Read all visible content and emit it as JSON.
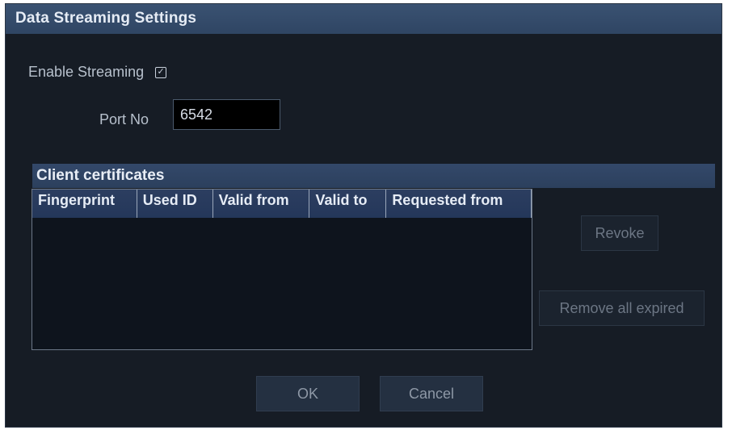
{
  "dialog": {
    "title": "Data Streaming Settings"
  },
  "streaming": {
    "enable_label": "Enable Streaming",
    "enabled": true,
    "port_label": "Port No",
    "port_value": "6542"
  },
  "certificates": {
    "group_title": "Client certificates",
    "columns": [
      "Fingerprint",
      "Used ID",
      "Valid from",
      "Valid to",
      "Requested from"
    ],
    "rows": []
  },
  "buttons": {
    "revoke": "Revoke",
    "remove_all_expired": "Remove all expired",
    "ok": "OK",
    "cancel": "Cancel"
  },
  "colors": {
    "dialog_bg": "#161c25",
    "titlebar": "#34496a",
    "header_accent": "#2c405d"
  }
}
